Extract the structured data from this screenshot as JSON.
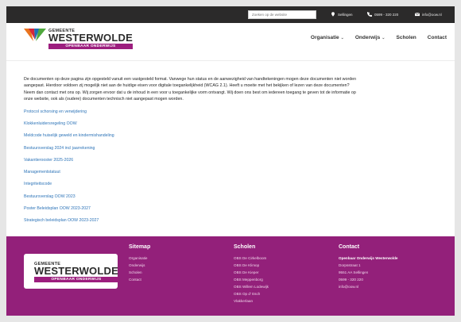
{
  "topbar": {
    "search_placeholder": "Zoeken op de website",
    "location": "Sellingen",
    "phone": "0599 - 320 220",
    "email": "info@oow.nl"
  },
  "brand": {
    "gemeente": "GEMEENTE",
    "name": "WESTERWOLDE",
    "subtitle": "OPENBAAR ONDERWIJS",
    "colors": {
      "purple": "#93207a",
      "orange": "#e9741e",
      "red": "#d6263a",
      "blue": "#1f6fb5",
      "green": "#4fa83d"
    }
  },
  "nav": {
    "items": [
      {
        "label": "Organisatie",
        "dropdown": true
      },
      {
        "label": "Onderwijs",
        "dropdown": true
      },
      {
        "label": "Scholen",
        "dropdown": false
      },
      {
        "label": "Contact",
        "dropdown": false
      }
    ]
  },
  "main": {
    "intro": "De documenten op deze pagina zijn opgesteld vanuit een vastgesteld format. Vanwege hun status en de aanwezigheid van handtekeningen mogen deze documenten niet worden aangepast. Hierdoor voldoen zij mogelijk niet aan de huidige eisen voor digitale toegankelijkheid (WCAG 2.1). Heeft u moeite met het bekijken of lezen van deze documenten? Neem dan contact met ons op. Wij zorgen ervoor dat u de inhoud in een voor u toegankelijke vorm ontvangt. Wij doen ons best om iedereen toegang te geven tot de informatie op onze website, ook als (oudere) documenten technisch niet aangepast mogen worden.",
    "links": [
      "Protocol schorsing en verwijdering",
      "Klokkenluidersregeling OOW",
      "Meldcode huiselijk geweld en kindermishandeling",
      "Bestuursverslag 2024 incl jaarrekening",
      "Vakantierooster 2025-2026",
      "Managementstatuut",
      "Integriteitscode",
      "Bestuursverslag OOW 2023",
      "Poster Beleidsplan OOW 2023-2027",
      "Strategisch beleidsplan OOW 2023-2027"
    ]
  },
  "footer": {
    "sitemap": {
      "title": "Sitemap",
      "items": [
        "Organisatie",
        "Onderwijs",
        "Scholen",
        "Contact"
      ]
    },
    "scholen": {
      "title": "Scholen",
      "items": [
        "OBS De Cirkelboom",
        "OBS De Klimop",
        "OBS De Kieper",
        "OBS Meppenborg",
        "OBS Willem Lodewijk",
        "OBS Op d' Esch",
        "Vlakkerlaan"
      ]
    },
    "contact": {
      "title": "Contact",
      "org": "Openbaar Onderwijs Westerwolde",
      "address": "Dorpsstraat 1",
      "city": "9551 AA Sellingen",
      "phone": "0599 - 320 220",
      "email": "info@oow.nl"
    }
  }
}
